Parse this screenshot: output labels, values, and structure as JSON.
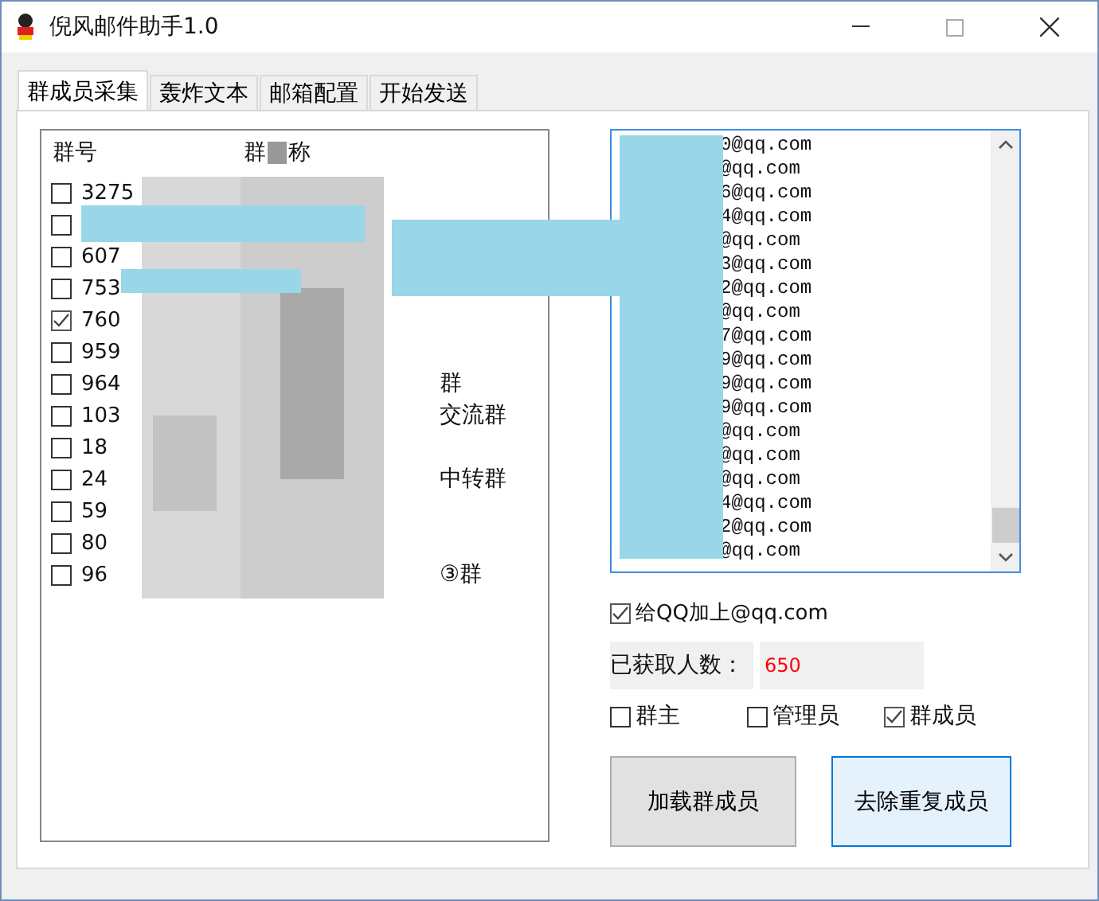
{
  "window": {
    "title": "倪风邮件助手1.0"
  },
  "tabs": [
    {
      "label": "群成员采集",
      "selected": true
    },
    {
      "label": "轰炸文本",
      "selected": false
    },
    {
      "label": "邮箱配置",
      "selected": false
    },
    {
      "label": "开始发送",
      "selected": false
    }
  ],
  "group_list": {
    "header_1": "群号",
    "header_2_parts": [
      "群",
      "称"
    ],
    "rows": [
      {
        "number": "3275",
        "name": "",
        "checked": false
      },
      {
        "number": "",
        "name": "",
        "checked": false
      },
      {
        "number": "607",
        "name": "",
        "checked": false
      },
      {
        "number": "753",
        "name": "",
        "checked": false
      },
      {
        "number": "760",
        "name": "",
        "checked": true
      },
      {
        "number": "959",
        "name": "",
        "checked": false
      },
      {
        "number": "964",
        "name": "群",
        "checked": false
      },
      {
        "number": "103",
        "name": "交流群",
        "checked": false
      },
      {
        "number": "18",
        "name": "",
        "checked": false
      },
      {
        "number": "24",
        "name": "中转群",
        "checked": false
      },
      {
        "number": "59",
        "name": "",
        "checked": false
      },
      {
        "number": "80",
        "name": "",
        "checked": false
      },
      {
        "number": "96",
        "name": "③群",
        "checked": false
      }
    ]
  },
  "emails": [
    "0@qq.com",
    "@qq.com",
    "6@qq.com",
    "4@qq.com",
    "@qq.com",
    "3@qq.com",
    "2@qq.com",
    "@qq.com",
    "7@qq.com",
    "9@qq.com",
    "9@qq.com",
    "9@qq.com",
    "@qq.com",
    "@qq.com",
    "@qq.com",
    "4@qq.com",
    "2@qq.com",
    "@qq.com"
  ],
  "append_domain": {
    "label": "给QQ加上@qq.com",
    "checked": true
  },
  "count": {
    "label": "已获取人数：",
    "value": "650"
  },
  "roles": [
    {
      "label": "群主",
      "checked": false
    },
    {
      "label": "管理员",
      "checked": false
    },
    {
      "label": "群成员",
      "checked": true
    }
  ],
  "buttons": [
    {
      "label": "加载群成员",
      "selected": false
    },
    {
      "label": "去除重复成员",
      "selected": true
    }
  ]
}
